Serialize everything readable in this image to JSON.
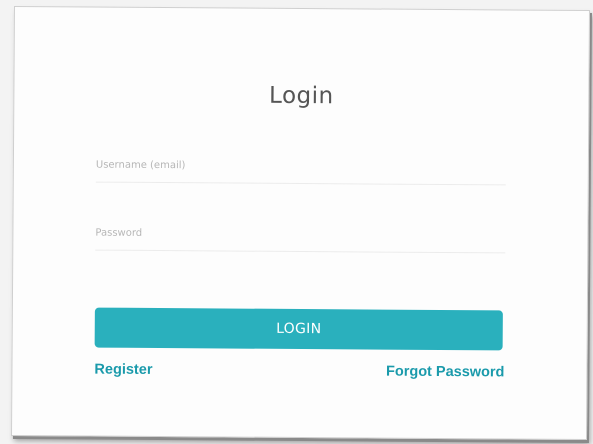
{
  "login_form": {
    "title": "Login",
    "username_placeholder": "Username (email)",
    "username_value": "",
    "password_placeholder": "Password",
    "password_value": "",
    "login_button_label": "LOGIN",
    "register_link": "Register",
    "forgot_password_link": "Forgot Password"
  },
  "colors": {
    "accent": "#2ab0bd",
    "link": "#1a9aab",
    "title_text": "#555555"
  }
}
